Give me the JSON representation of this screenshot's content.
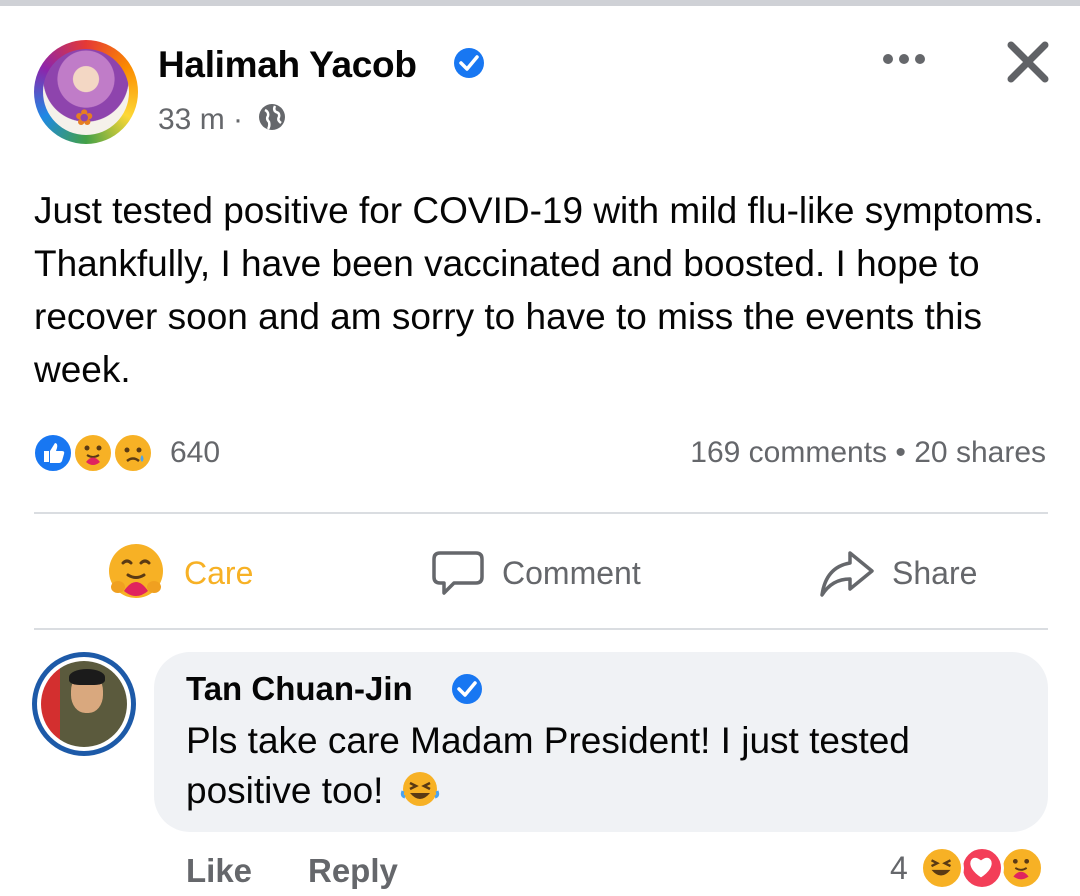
{
  "post": {
    "author": "Halimah Yacob",
    "time": "33 m",
    "separator": "·",
    "text": "Just tested positive for COVID-19 with mild flu-like symptoms. Thankfully, I have been vaccinated and boosted. I hope to recover soon and am sorry to have to miss the events this week.",
    "reaction_count": "640",
    "comments_count": "169 comments",
    "stats_separator": "•",
    "shares_count": "20 shares"
  },
  "actions": {
    "care": "Care",
    "comment": "Comment",
    "share": "Share"
  },
  "comment": {
    "author": "Tan Chuan-Jin",
    "text": "Pls take care Madam President! I just tested positive too!",
    "like": "Like",
    "reply": "Reply",
    "reaction_count": "4"
  },
  "colors": {
    "facebook_blue": "#1877f2",
    "care_yellow": "#f7b125",
    "secondary_text": "#65676b",
    "bubble_bg": "#f0f2f5"
  },
  "icons": [
    "verified-badge-icon",
    "globe-icon",
    "more-icon",
    "close-icon",
    "like-reaction-icon",
    "care-reaction-icon",
    "sad-reaction-icon",
    "comment-icon",
    "share-icon",
    "laughing-emoji-icon",
    "haha-reaction-icon",
    "love-reaction-icon"
  ]
}
